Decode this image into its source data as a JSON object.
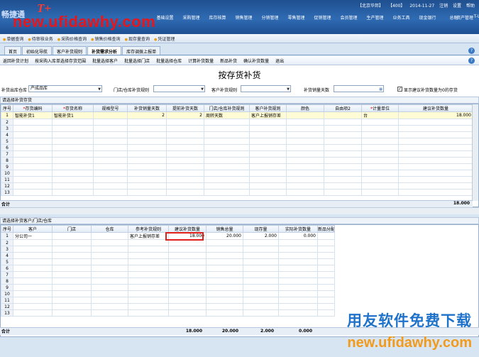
{
  "header": {
    "logo": "畅捷通",
    "status": [
      "【北京华邦】",
      "【400】",
      "2014-11-27",
      "注销",
      "设置",
      "帮助"
    ],
    "menu": [
      "",
      "",
      "基础设置",
      "采购管理",
      "库存核算",
      "销售管理",
      "分销管理",
      "零售管理",
      "促销管理",
      "会员管理",
      "生产管理",
      "业务工具",
      "现金银行",
      "总账",
      "T-UFO",
      "资产管理"
    ]
  },
  "watermark": {
    "top": "new.ufidawhy.com",
    "tplus": "T+",
    "cn": "用友软件免费下载",
    "url": "new.ufidawhy.com"
  },
  "quickbar": [
    "单据查询",
    "待审核业务",
    "采购价格查询",
    "销售价格查询",
    "现存量查询",
    "凭证管理"
  ],
  "tabs": [
    "首页",
    "初始化导航",
    "客户补货规则",
    "补货需求分析",
    "库存调拨上报单"
  ],
  "active_tab": 3,
  "help": "?",
  "toolbar": [
    "返回补货计划",
    "按采购入库单选择存货范围",
    "批量选择客户",
    "批量选择门店",
    "批量选择仓库",
    "计算补货数量",
    "新品补货",
    "确认补货数量",
    "退出"
  ],
  "form": {
    "title": "按存货补货",
    "warehouse_label": "补货出库仓库",
    "warehouse_value": "产成品库",
    "store_rule_label": "门店/仓库补货规则",
    "store_rule_value": "",
    "customer_rule_label": "客户补货规则",
    "customer_rule_value": "",
    "days_label": "补货销量天数",
    "days_value": "",
    "show_zero_label": "显示建议补货数量为0的存货",
    "show_zero_checked": true
  },
  "grid1": {
    "section_label": "请选择补货存货",
    "headers": [
      "序号",
      "存货编码",
      "存货名称",
      "规格型号",
      "补货销量天数",
      "提前补货天数",
      "门店/仓库补货规则",
      "客户补货规则",
      "颜色",
      "自由项2",
      "计量单位",
      "建议补货数量"
    ],
    "required": [
      false,
      true,
      true,
      false,
      false,
      false,
      false,
      false,
      false,
      false,
      true,
      false
    ],
    "rows": [
      [
        "1",
        "智能补货1",
        "智能补货1",
        "",
        "2",
        "2",
        "周转天数",
        "客户上报销存差",
        "",
        "",
        "台",
        "18.000"
      ]
    ],
    "total_label": "合计",
    "total_value": "18.000"
  },
  "grid2": {
    "section_label": "请选择补货客户/门店/仓库",
    "headers": [
      "序号",
      "客户",
      "门店",
      "仓库",
      "参考补货规则",
      "建议补货数量",
      "销售总量",
      "现存量",
      "实际补货数量",
      "新品分配比重"
    ],
    "rows": [
      [
        "1",
        "分公司一",
        "",
        "",
        "客户上报销存差",
        "18.000",
        "20.000",
        "2.000",
        "0.000",
        ""
      ]
    ],
    "total_label": "合计",
    "totals": [
      "",
      "",
      "",
      "",
      "18.000",
      "20.000",
      "2.000",
      "0.000",
      ""
    ]
  },
  "colors": {
    "required": "#e00000",
    "highlight": "#e0201b",
    "banner": "#2f6bb3",
    "selected_row": "#fffbd4"
  }
}
